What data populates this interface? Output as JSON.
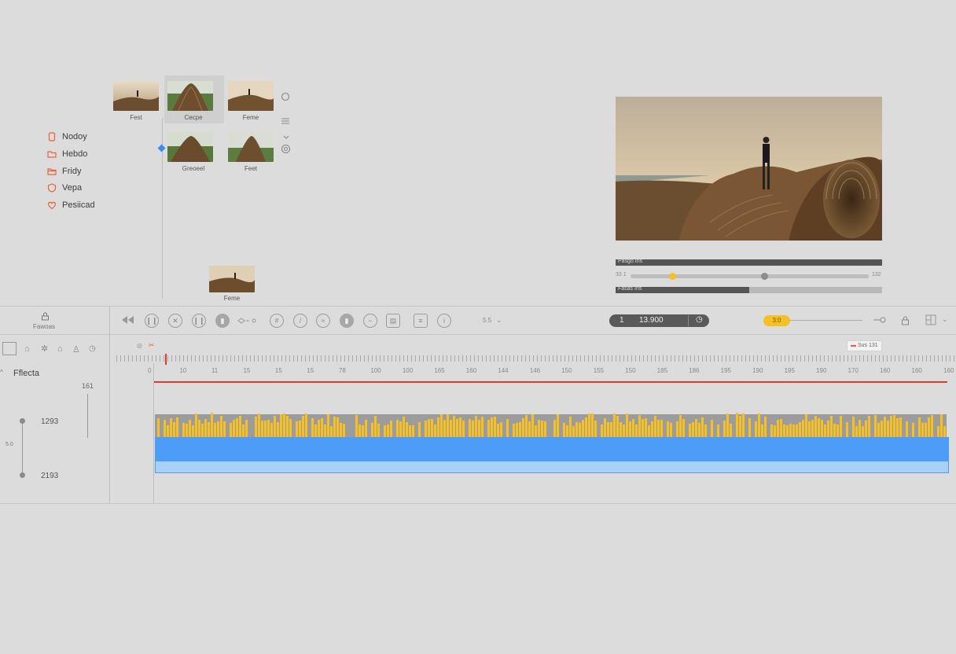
{
  "sidebar": {
    "items": [
      {
        "label": "Nodoy",
        "icon": "doc-icon"
      },
      {
        "label": "Hebdo",
        "icon": "folder-icon"
      },
      {
        "label": "Fridy",
        "icon": "folder-open-icon"
      },
      {
        "label": "Vepa",
        "icon": "shield-icon"
      },
      {
        "label": "Pesiicad",
        "icon": "heart-icon"
      }
    ]
  },
  "media": {
    "thumbs": [
      {
        "label": "Fest"
      },
      {
        "label": "Cecpe"
      },
      {
        "label": "Feme"
      },
      {
        "label": "Greoeel"
      },
      {
        "label": "Feet"
      },
      {
        "label": "Feme"
      }
    ]
  },
  "preview": {
    "top_bar_label": "Pasgo Ins",
    "slider_left": "33 1",
    "slider_right": "132",
    "bottom_bar_label": "Fasas Ins"
  },
  "toolbar": {
    "panel_label": "Fawoas",
    "speed_label": "5.5",
    "timecode_left": "1",
    "timecode_value": "13.900",
    "zoom_badge": "3:0"
  },
  "timeline": {
    "effects_label": "Fflecta",
    "marker_label": "Sus 131",
    "ruler": [
      "0",
      "10",
      "11",
      "15",
      "15",
      "15",
      "78",
      "100",
      "100",
      "165",
      "160",
      "144",
      "146",
      "150",
      "155",
      "150",
      "185",
      "186",
      "195",
      "190",
      "195",
      "190",
      "170",
      "160",
      "160",
      "160"
    ],
    "side_values": {
      "top": "161",
      "mid": "1293",
      "left": "5.0",
      "bottom": "2193"
    }
  },
  "colors": {
    "accent_orange": "#e8613a",
    "waveform": "#f5c024",
    "clip_blue": "#4d9cf8",
    "playhead": "#e23a2a"
  }
}
